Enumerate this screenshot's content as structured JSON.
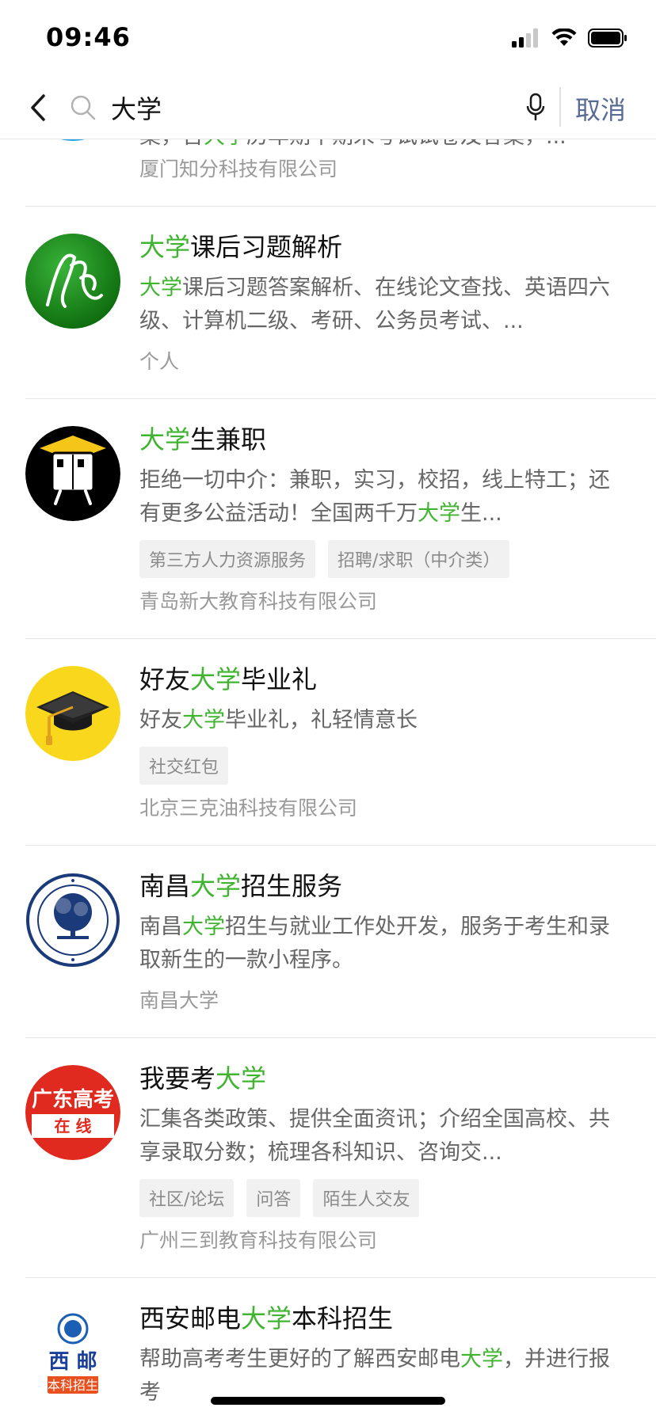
{
  "status": {
    "time": "09:46"
  },
  "search": {
    "query": "大学",
    "cancel": "取消"
  },
  "results": [
    {
      "id": 0,
      "title_parts": [],
      "desc_parts": [
        {
          "t": "案，含",
          "h": false
        },
        {
          "t": "大学",
          "h": true
        },
        {
          "t": "历年期中期末考试试卷及答案，...",
          "h": false
        }
      ],
      "tags": [],
      "owner": "厦门知分科技有限公司",
      "logo": "partial-blue-logo"
    },
    {
      "id": 1,
      "title_parts": [
        {
          "t": "大学",
          "h": true
        },
        {
          "t": "课后习题解析",
          "h": false
        }
      ],
      "desc_parts": [
        {
          "t": "大学",
          "h": true
        },
        {
          "t": "课后习题答案解析、在线论文查找、英语四六级、计算机二级、考研、公务员考试、...",
          "h": false
        }
      ],
      "tags": [],
      "owner": "个人",
      "logo": "green-calligraphy-logo"
    },
    {
      "id": 2,
      "title_parts": [
        {
          "t": "大学",
          "h": true
        },
        {
          "t": "生兼职",
          "h": false
        }
      ],
      "desc_parts": [
        {
          "t": "拒绝一切中介：兼职，实习，校招，线上特工；还有更多公益活动！全国两千万",
          "h": false
        },
        {
          "t": "大学",
          "h": true
        },
        {
          "t": "生...",
          "h": false
        }
      ],
      "tags": [
        "第三方人力资源服务",
        "招聘/求职（中介类）"
      ],
      "owner": "青岛新大教育科技有限公司",
      "logo": "graduate-cube-logo"
    },
    {
      "id": 3,
      "title_parts": [
        {
          "t": "好友",
          "h": false
        },
        {
          "t": "大学",
          "h": true
        },
        {
          "t": "毕业礼",
          "h": false
        }
      ],
      "desc_parts": [
        {
          "t": "好友",
          "h": false
        },
        {
          "t": "大学",
          "h": true
        },
        {
          "t": "毕业礼，礼轻情意长",
          "h": false
        }
      ],
      "tags": [
        "社交红包"
      ],
      "owner": "北京三克油科技有限公司",
      "logo": "mortarboard-yellow-logo"
    },
    {
      "id": 4,
      "title_parts": [
        {
          "t": "南昌",
          "h": false
        },
        {
          "t": "大学",
          "h": true
        },
        {
          "t": "招生服务",
          "h": false
        }
      ],
      "desc_parts": [
        {
          "t": "南昌",
          "h": false
        },
        {
          "t": "大学",
          "h": true
        },
        {
          "t": "招生与就业工作处开发，服务于考生和录取新生的一款小程序。",
          "h": false
        }
      ],
      "tags": [],
      "owner": "南昌大学",
      "logo": "university-seal-logo"
    },
    {
      "id": 5,
      "title_parts": [
        {
          "t": "我要考",
          "h": false
        },
        {
          "t": "大学",
          "h": true
        }
      ],
      "desc_parts": [
        {
          "t": "汇集各类政策、提供全面资讯；介绍全国高校、共享录取分数；梳理各科知识、咨询交...",
          "h": false
        }
      ],
      "tags": [
        "社区/论坛",
        "问答",
        "陌生人交友"
      ],
      "owner": "广州三到教育科技有限公司",
      "logo": "guangdong-gaokao-logo",
      "logo_text": {
        "top": "广东高考",
        "bottom": "在 线"
      }
    },
    {
      "id": 6,
      "title_parts": [
        {
          "t": "西安邮电",
          "h": false
        },
        {
          "t": "大学",
          "h": true
        },
        {
          "t": "本科招生",
          "h": false
        }
      ],
      "desc_parts": [
        {
          "t": "帮助高考考生更好的了解西安邮电",
          "h": false
        },
        {
          "t": "大学",
          "h": true
        },
        {
          "t": "，并进行报考",
          "h": false
        }
      ],
      "tags": [],
      "owner": "",
      "logo": "xupt-logo",
      "logo_text": {
        "main": "西 邮",
        "badge": "本科招生"
      }
    }
  ]
}
